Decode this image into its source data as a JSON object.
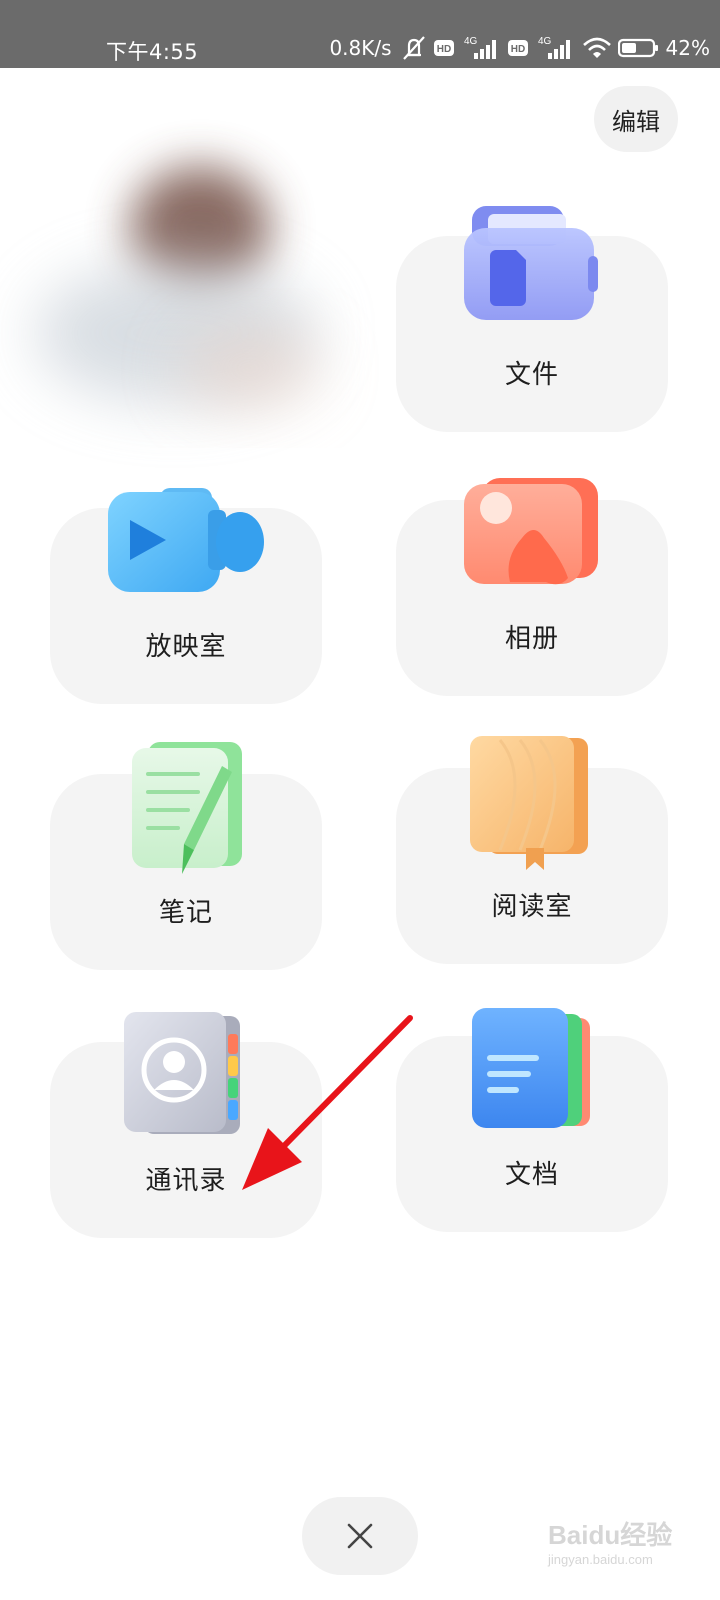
{
  "status_bar": {
    "time": "下午4:55",
    "net_speed": "0.8K/s",
    "battery": "42%",
    "icons": [
      "mute-icon",
      "hd-icon",
      "signal-4g-icon",
      "hd-icon",
      "signal-4g-icon",
      "wifi-icon",
      "battery-icon"
    ]
  },
  "header": {
    "edit_label": "编辑"
  },
  "tiles": [
    {
      "label": "文件",
      "icon": "folder-icon"
    },
    {
      "label": "放映室",
      "icon": "video-camera-icon"
    },
    {
      "label": "相册",
      "icon": "gallery-icon"
    },
    {
      "label": "笔记",
      "icon": "notes-icon"
    },
    {
      "label": "阅读室",
      "icon": "book-icon"
    },
    {
      "label": "通讯录",
      "icon": "contacts-icon"
    },
    {
      "label": "文档",
      "icon": "document-icon"
    }
  ],
  "close": {
    "icon": "close-icon"
  },
  "watermark": {
    "text": "Baidu经验",
    "sub": "jingyan.baidu.com"
  },
  "colors": {
    "status_bar": "#6b6b6b",
    "tile_bg": "#f4f4f4",
    "arrow": "#e8141a"
  }
}
